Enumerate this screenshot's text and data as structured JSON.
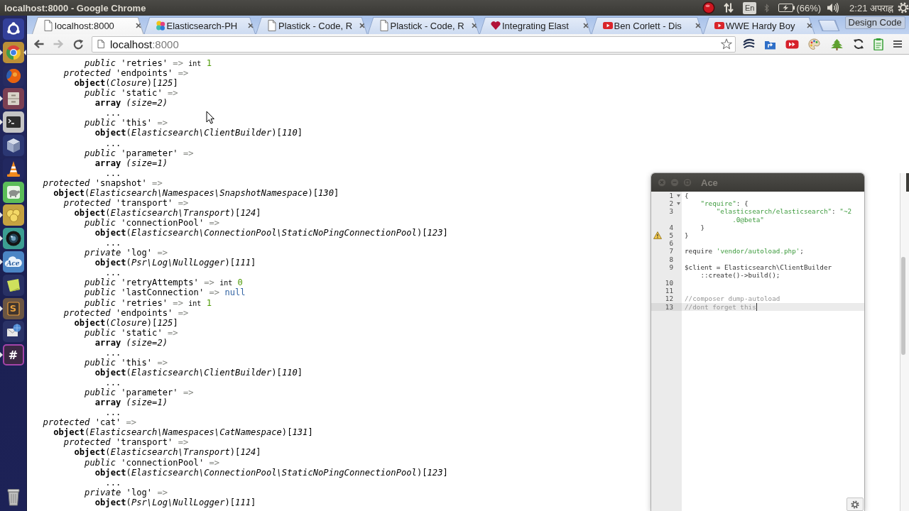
{
  "top_panel": {
    "title": "localhost:8000 - Google Chrome",
    "keyboard_layout": "En",
    "battery_reading": "(66%)",
    "clock": "2:21 अपराह्न"
  },
  "launcher": {
    "items": [
      {
        "kind": "ring",
        "running": false,
        "focused": false
      },
      {
        "kind": "wheel",
        "running": true,
        "focused": true
      },
      {
        "kind": "globe",
        "running": false,
        "focused": false
      },
      {
        "kind": "drawer",
        "running": true,
        "focused": false
      },
      {
        "kind": "terminal",
        "running": true,
        "focused": false
      },
      {
        "kind": "cube",
        "running": false,
        "focused": false
      },
      {
        "kind": "cone",
        "running": false,
        "focused": false
      },
      {
        "kind": "turtle",
        "running": false,
        "focused": false
      },
      {
        "kind": "blob",
        "running": true,
        "focused": false
      },
      {
        "kind": "lens",
        "running": true,
        "focused": false
      },
      {
        "kind": "cloud",
        "running": true,
        "focused": false,
        "logo_text": "Ace"
      },
      {
        "kind": "note",
        "running": false,
        "focused": false
      },
      {
        "kind": "letter",
        "running": true,
        "focused": false,
        "logo_text": "S"
      },
      {
        "kind": "mail",
        "running": false,
        "focused": false
      },
      {
        "kind": "hash",
        "running": true,
        "focused": false,
        "logo_text": "#"
      },
      {
        "kind": "trash",
        "running": false,
        "focused": false
      }
    ]
  },
  "browser": {
    "tabs": [
      {
        "kind": "page",
        "title": "localhost:8000",
        "selected": true
      },
      {
        "kind": "logo",
        "title": "Elasticsearch-PH",
        "selected": false
      },
      {
        "kind": "page",
        "title": "Plastick - Code, R",
        "selected": false
      },
      {
        "kind": "page",
        "title": "Plastick - Code, R",
        "selected": false
      },
      {
        "kind": "heart",
        "title": "Integrating Elast",
        "selected": false
      },
      {
        "kind": "video",
        "title": "Ben Corlett - Dis",
        "selected": false
      },
      {
        "kind": "video",
        "title": "WWE Hardy Boy",
        "selected": false
      }
    ],
    "profile": "Design Code",
    "nav_buttons": [
      {
        "kind": "back",
        "disabled": false
      },
      {
        "kind": "forward",
        "disabled": true
      },
      {
        "kind": "reload",
        "disabled": false
      }
    ],
    "address": {
      "host": "localhost",
      "port": ":8000"
    },
    "page": {
      "dump": [
        {
          "children": [
            {
              "children": [
                {
                  "children": [
                    {
                      "children": [
                        {
                          "text": "*public* 'retries'",
                          "arrow": "=>",
                          "type": "int",
                          "value": {
                            "kind": "int",
                            "text": "1"
                          }
                        }
                      ]
                    }
                  ]
                },
                {
                  "text": "*protected* 'endpoints'",
                  "arrow": "=>",
                  "children": [
                    {
                      "text": "**object**(*Closure*)[*125*]",
                      "children": [
                        {
                          "text": "*public* 'static'",
                          "arrow": "=>",
                          "children": [
                            {
                              "text": "**array** *(size=2)*",
                              "children": [
                                {
                                  "text": "..."
                                }
                              ]
                            }
                          ]
                        },
                        {
                          "text": "*public* 'this'",
                          "arrow": "=>",
                          "children": [
                            {
                              "text": "**object**(*Elasticsearch\\ClientBuilder*)[*110*]",
                              "children": [
                                {
                                  "text": "..."
                                }
                              ]
                            }
                          ]
                        },
                        {
                          "text": "*public* 'parameter'",
                          "arrow": "=>",
                          "children": [
                            {
                              "text": "**array** *(size=1)*",
                              "children": [
                                {
                                  "text": "..."
                                }
                              ]
                            }
                          ]
                        }
                      ]
                    }
                  ]
                }
              ]
            }
          ]
        },
        {
          "text": "*protected* 'snapshot'",
          "arrow": "=>",
          "children": [
            {
              "text": "**object**(*Elasticsearch\\Namespaces\\SnapshotNamespace*)[*130*]",
              "children": [
                {
                  "text": "*protected* 'transport'",
                  "arrow": "=>",
                  "children": [
                    {
                      "text": "**object**(*Elasticsearch\\Transport*)[*124*]",
                      "children": [
                        {
                          "text": "*public* 'connectionPool'",
                          "arrow": "=>",
                          "children": [
                            {
                              "text": "**object**(*Elasticsearch\\ConnectionPool\\StaticNoPingConnectionPool*)[*123*]",
                              "children": [
                                {
                                  "text": "..."
                                }
                              ]
                            }
                          ]
                        },
                        {
                          "text": "*private* 'log'",
                          "arrow": "=>",
                          "children": [
                            {
                              "text": "**object**(*Psr\\Log\\NullLogger*)[*111*]",
                              "children": [
                                {
                                  "text": "..."
                                }
                              ]
                            }
                          ]
                        },
                        {
                          "text": "*public* 'retryAttempts'",
                          "arrow": "=>",
                          "type": "int",
                          "value": {
                            "kind": "int",
                            "text": "0"
                          }
                        },
                        {
                          "text": "*public* 'lastConnection'",
                          "arrow": "=>",
                          "value": {
                            "kind": "null",
                            "text": "null"
                          }
                        },
                        {
                          "text": "*public* 'retries'",
                          "arrow": "=>",
                          "type": "int",
                          "value": {
                            "kind": "int",
                            "text": "1"
                          }
                        }
                      ]
                    }
                  ]
                },
                {
                  "text": "*protected* 'endpoints'",
                  "arrow": "=>",
                  "children": [
                    {
                      "text": "**object**(*Closure*)[*125*]",
                      "children": [
                        {
                          "text": "*public* 'static'",
                          "arrow": "=>",
                          "children": [
                            {
                              "text": "**array** *(size=2)*",
                              "children": [
                                {
                                  "text": "..."
                                }
                              ]
                            }
                          ]
                        },
                        {
                          "text": "*public* 'this'",
                          "arrow": "=>",
                          "children": [
                            {
                              "text": "**object**(*Elasticsearch\\ClientBuilder*)[*110*]",
                              "children": [
                                {
                                  "text": "..."
                                }
                              ]
                            }
                          ]
                        },
                        {
                          "text": "*public* 'parameter'",
                          "arrow": "=>",
                          "children": [
                            {
                              "text": "**array** *(size=1)*",
                              "children": [
                                {
                                  "text": "..."
                                }
                              ]
                            }
                          ]
                        }
                      ]
                    }
                  ]
                }
              ]
            }
          ]
        },
        {
          "text": "*protected* 'cat'",
          "arrow": "=>",
          "children": [
            {
              "text": "**object**(*Elasticsearch\\Namespaces\\CatNamespace*)[*131*]",
              "children": [
                {
                  "text": "*protected* 'transport'",
                  "arrow": "=>",
                  "children": [
                    {
                      "text": "**object**(*Elasticsearch\\Transport*)[*124*]",
                      "children": [
                        {
                          "text": "*public* 'connectionPool'",
                          "arrow": "=>",
                          "children": [
                            {
                              "text": "**object**(*Elasticsearch\\ConnectionPool\\StaticNoPingConnectionPool*)[*123*]",
                              "children": [
                                {
                                  "text": "..."
                                }
                              ]
                            }
                          ]
                        },
                        {
                          "text": "*private* 'log'",
                          "arrow": "=>",
                          "children": [
                            {
                              "text": "**object**(*Psr\\Log\\NullLogger*)[*111*]"
                            }
                          ]
                        }
                      ]
                    }
                  ]
                }
              ]
            }
          ]
        }
      ]
    }
  },
  "ace_window": {
    "title": "Ace",
    "lines": [
      {
        "number": "1",
        "fold": true,
        "warning": false,
        "active": false,
        "rows": [
          [
            {
              "kind": "text",
              "text": "{"
            }
          ]
        ]
      },
      {
        "number": "2",
        "fold": true,
        "warning": false,
        "active": false,
        "rows": [
          [
            {
              "kind": "string",
              "text": "    \"require\""
            },
            {
              "kind": "text",
              "text": ": {"
            }
          ]
        ]
      },
      {
        "number": "3",
        "fold": false,
        "warning": false,
        "active": false,
        "rows": [
          [
            {
              "kind": "string",
              "text": "        \"elasticsearch/elasticsearch\""
            },
            {
              "kind": "text",
              "text": ": "
            },
            {
              "kind": "string",
              "text": "\"~2"
            }
          ],
          [
            {
              "kind": "string",
              "text": "            .0@beta\""
            }
          ]
        ]
      },
      {
        "number": "4",
        "fold": false,
        "warning": false,
        "active": false,
        "rows": [
          [
            {
              "kind": "text",
              "text": "    }"
            }
          ]
        ]
      },
      {
        "number": "5",
        "fold": false,
        "warning": true,
        "active": false,
        "rows": [
          [
            {
              "kind": "text",
              "text": "}"
            }
          ]
        ]
      },
      {
        "number": "6",
        "fold": false,
        "warning": false,
        "active": false
      },
      {
        "number": "7",
        "fold": false,
        "warning": false,
        "active": false,
        "rows": [
          [
            {
              "kind": "text",
              "text": "require "
            },
            {
              "kind": "string",
              "text": "'vendor/autoload.php'"
            },
            {
              "kind": "text",
              "text": ";"
            }
          ]
        ]
      },
      {
        "number": "8",
        "fold": false,
        "warning": false,
        "active": false
      },
      {
        "number": "9",
        "fold": false,
        "warning": false,
        "active": false,
        "rows": [
          [
            {
              "kind": "text",
              "text": "$client = Elasticsearch\\ClientBuilder"
            }
          ],
          [
            {
              "kind": "text",
              "text": "    ::create()->build();"
            }
          ]
        ]
      },
      {
        "number": "10",
        "fold": false,
        "warning": false,
        "active": false
      },
      {
        "number": "11",
        "fold": false,
        "warning": false,
        "active": false
      },
      {
        "number": "12",
        "fold": false,
        "warning": false,
        "active": false,
        "rows": [
          [
            {
              "kind": "comment",
              "text": "//composer dump-autoload"
            }
          ]
        ]
      },
      {
        "number": "13",
        "fold": false,
        "warning": false,
        "active": true,
        "rows": [
          [
            {
              "kind": "comment",
              "text": "//dont forget this"
            }
          ]
        ]
      }
    ]
  }
}
